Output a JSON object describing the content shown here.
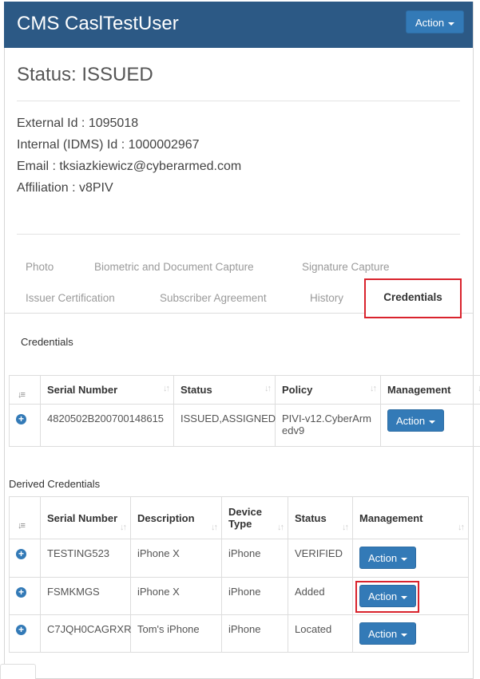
{
  "header": {
    "title": "CMS CaslTestUser",
    "action_label": "Action"
  },
  "status": {
    "label": "Status: ISSUED"
  },
  "info": {
    "external_id": "External Id : 1095018",
    "internal_id": "Internal (IDMS) Id : 1000002967",
    "email": "Email : tksiazkiewicz@cyberarmed.com",
    "affiliation": "Affiliation : v8PIV"
  },
  "tabs": {
    "photo": "Photo",
    "biometric": "Biometric and Document Capture",
    "signature": "Signature Capture",
    "issuer": "Issuer Certification",
    "subscriber": "Subscriber Agreement",
    "history": "History",
    "credentials": "Credentials"
  },
  "credentials": {
    "section_label": "Credentials",
    "columns": [
      "Serial Number",
      "Status",
      "Policy",
      "Management"
    ],
    "rows": [
      {
        "serial": "4820502B200700148615",
        "status": "ISSUED,ASSIGNED",
        "policy": "PIVI-v12.CyberArmedv9",
        "action": "Action"
      }
    ]
  },
  "derived": {
    "section_label": "Derived Credentials",
    "columns": [
      "Serial Number",
      "Description",
      "Device Type",
      "Status",
      "Management"
    ],
    "rows": [
      {
        "serial": "TESTING523",
        "description": "iPhone X",
        "device": "iPhone",
        "status": "VERIFIED",
        "action": "Action"
      },
      {
        "serial": "FSMKMGS",
        "description": "iPhone X",
        "device": "iPhone",
        "status": "Added",
        "action": "Action"
      },
      {
        "serial": "C7JQH0CAGRXR",
        "description": "Tom's iPhone",
        "device": "iPhone",
        "status": "Located",
        "action": "Action"
      }
    ]
  },
  "icons": {
    "expand": "plus-circle-icon",
    "sort": "sort-arrows-icon",
    "caret": "caret-down-icon"
  },
  "colors": {
    "header_bg": "#2c5985",
    "button": "#337ab7",
    "highlight": "#d9232d"
  }
}
